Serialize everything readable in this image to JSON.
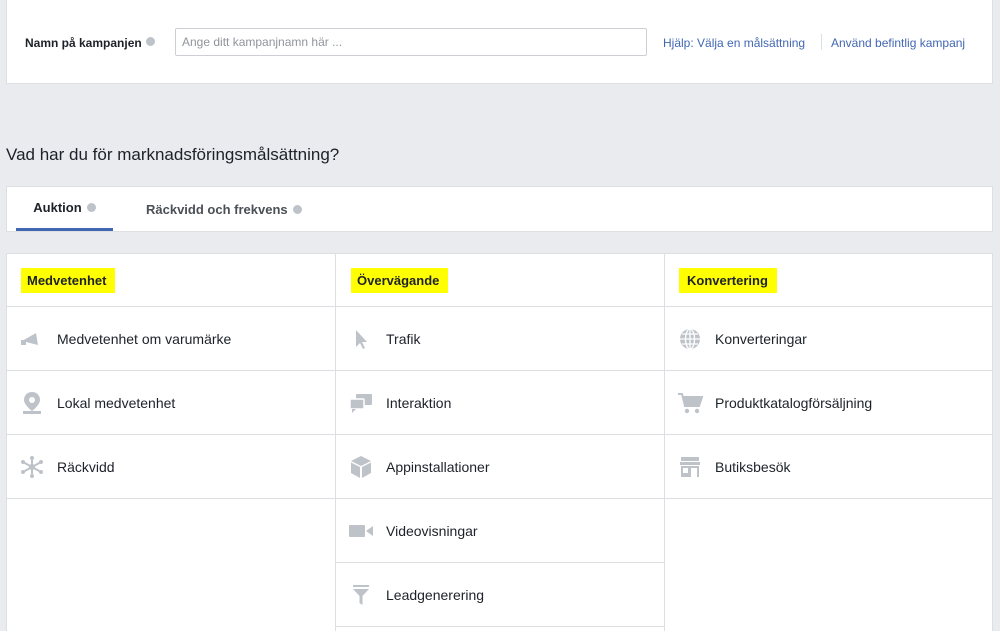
{
  "campaign": {
    "label": "Namn på kampanjen",
    "placeholder": "Ange ditt kampanjnamn här ...",
    "value": "",
    "help_link": "Hjälp: Välja en målsättning",
    "existing_link": "Använd befintlig kampanj"
  },
  "question": "Vad har du för marknadsföringsmålsättning?",
  "tabs": [
    {
      "label": "Auktion",
      "active": true
    },
    {
      "label": "Räckvidd och frekvens",
      "active": false
    }
  ],
  "colors": {
    "accent": "#4267b2",
    "highlight": "#ffff00",
    "icon": "#bec3c9"
  },
  "columns": [
    {
      "heading": "Medvetenhet",
      "items": [
        {
          "label": "Medvetenhet om varumärke",
          "icon": "megaphone-icon"
        },
        {
          "label": "Lokal medvetenhet",
          "icon": "location-pin-icon"
        },
        {
          "label": "Räckvidd",
          "icon": "network-icon"
        }
      ]
    },
    {
      "heading": "Övervägande",
      "items": [
        {
          "label": "Trafik",
          "icon": "cursor-icon"
        },
        {
          "label": "Interaktion",
          "icon": "chat-bubbles-icon"
        },
        {
          "label": "Appinstallationer",
          "icon": "box-icon"
        },
        {
          "label": "Videovisningar",
          "icon": "video-camera-icon"
        },
        {
          "label": "Leadgenerering",
          "icon": "funnel-icon"
        }
      ]
    },
    {
      "heading": "Konvertering",
      "items": [
        {
          "label": "Konverteringar",
          "icon": "globe-icon"
        },
        {
          "label": "Produktkatalogförsäljning",
          "icon": "shopping-cart-icon"
        },
        {
          "label": "Butiksbesök",
          "icon": "store-icon"
        }
      ]
    }
  ]
}
